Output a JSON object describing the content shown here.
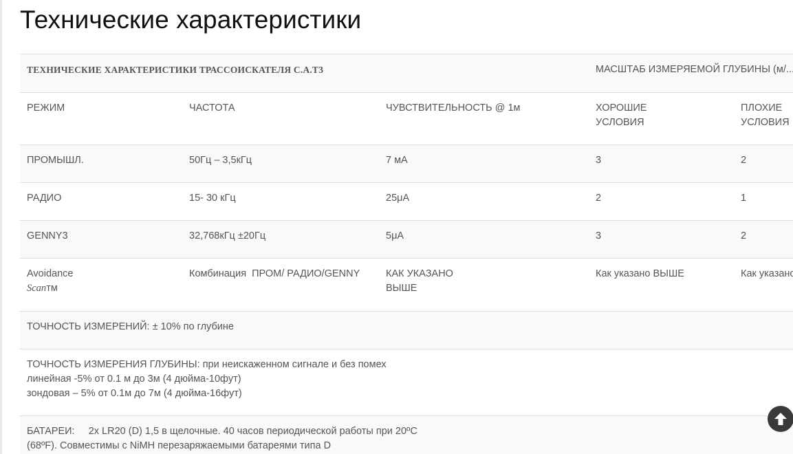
{
  "page": {
    "title": "Технические характеристики"
  },
  "table": {
    "header": {
      "title": "ТЕХНИЧЕСКИЕ ХАРАКТЕРИСТИКИ ТРАССОИСКАТЕЛЯ С.А.Т3",
      "depth_scale": "МАСШТАБ ИЗМЕРЯЕМОЙ ГЛУБИНЫ (м/..."
    },
    "columns": {
      "mode": "РЕЖИМ",
      "frequency": "ЧАСТОТА",
      "sensitivity": "ЧУВСТВИТЕЛЬНОСТЬ @ 1м",
      "good_line1": "ХОРОШИЕ",
      "good_line2": "УСЛОВИЯ",
      "bad_line1": "ПЛОХИЕ",
      "bad_line2": "УСЛОВИЯ"
    },
    "rows": [
      {
        "mode": "ПРОМЫШЛ.",
        "frequency": "50Гц – 3,5кГц",
        "sensitivity": "7 мА",
        "good": "3",
        "bad": "2"
      },
      {
        "mode": "РАДИО",
        "frequency": "15- 30 кГц",
        "sensitivity": "25μA",
        "good": "2",
        "bad": "1"
      },
      {
        "mode": "GENNY3",
        "frequency": "32,768кГц ±20Гц",
        "sensitivity": "5μA",
        "good": "3",
        "bad": "2"
      }
    ],
    "avoidance": {
      "mode_line1": "Avoidance",
      "mode_scan": "Scan",
      "mode_tm": "тм",
      "frequency": "Комбинация  ПРОМ/ РАДИО/GENNY",
      "sensitivity_line1": "КАК УКАЗАНО",
      "sensitivity_line2": "ВЫШЕ",
      "good": "Как указано ВЫШЕ",
      "bad": "Как указано ВЫШЕ"
    },
    "accuracy": "ТОЧНОСТЬ ИЗМЕРЕНИЙ: ± 10% по глубине",
    "depth_accuracy": {
      "line1": "ТОЧНОСТЬ ИЗМЕРЕНИЯ ГЛУБИНЫ: при неискаженном сигнале и без помех",
      "line2": "линейная -5% от 0.1 м до 3м (4 дюйма-10фут)",
      "line3": "зондовая – 5% от 0.1м до 7м (4 дюйма-16фут)"
    },
    "batteries": {
      "line1": "БАТАРЕИ:     2x LR20 (D) 1,5 в щелочные. 40 часов периодической работы при 20ºC",
      "line2": "(68ºF). Совместимы с NiMH перезаряжаемыми батареями типа D"
    }
  },
  "scroll_top": {
    "icon": "arrow-up-icon"
  }
}
